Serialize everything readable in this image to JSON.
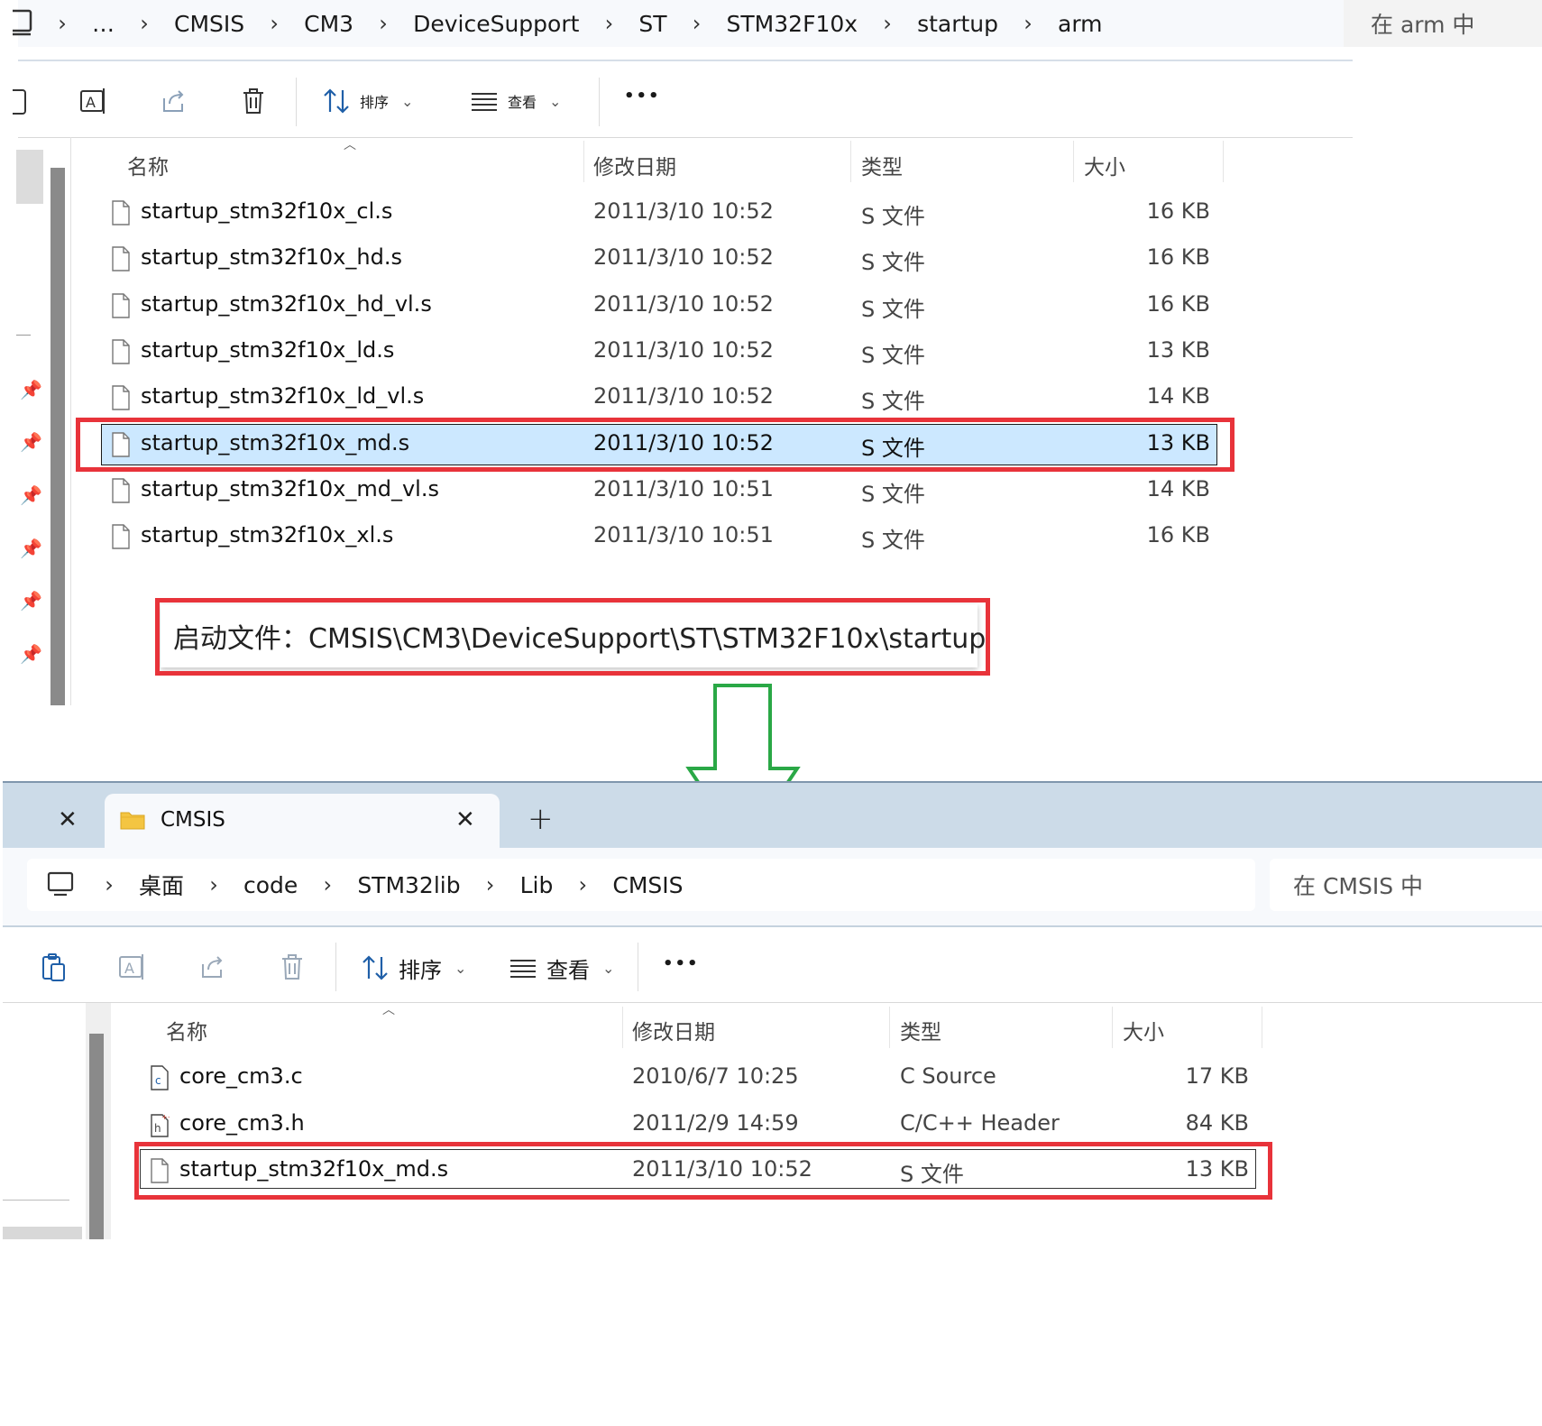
{
  "top": {
    "breadcrumb": [
      "…",
      "CMSIS",
      "CM3",
      "DeviceSupport",
      "ST",
      "STM32F10x",
      "startup",
      "arm"
    ],
    "search_placeholder": "在 arm 中",
    "toolbar": {
      "sort_label": "排序",
      "view_label": "查看",
      "more_label": "•••"
    },
    "columns": {
      "name": "名称",
      "date": "修改日期",
      "type": "类型",
      "size": "大小"
    },
    "files": [
      {
        "name": "startup_stm32f10x_cl.s",
        "date": "2011/3/10 10:52",
        "type": "S 文件",
        "size": "16 KB"
      },
      {
        "name": "startup_stm32f10x_hd.s",
        "date": "2011/3/10 10:52",
        "type": "S 文件",
        "size": "16 KB"
      },
      {
        "name": "startup_stm32f10x_hd_vl.s",
        "date": "2011/3/10 10:52",
        "type": "S 文件",
        "size": "16 KB"
      },
      {
        "name": "startup_stm32f10x_ld.s",
        "date": "2011/3/10 10:52",
        "type": "S 文件",
        "size": "13 KB"
      },
      {
        "name": "startup_stm32f10x_ld_vl.s",
        "date": "2011/3/10 10:52",
        "type": "S 文件",
        "size": "14 KB"
      },
      {
        "name": "startup_stm32f10x_md.s",
        "date": "2011/3/10 10:52",
        "type": "S 文件",
        "size": "13 KB",
        "selected": true
      },
      {
        "name": "startup_stm32f10x_md_vl.s",
        "date": "2011/3/10 10:51",
        "type": "S 文件",
        "size": "14 KB"
      },
      {
        "name": "startup_stm32f10x_xl.s",
        "date": "2011/3/10 10:51",
        "type": "S 文件",
        "size": "16 KB"
      }
    ]
  },
  "note": "启动文件：CMSIS\\CM3\\DeviceSupport\\ST\\STM32F10x\\startup",
  "bottom": {
    "tab": {
      "title": "CMSIS",
      "add_label": "+"
    },
    "breadcrumb": [
      "桌面",
      "code",
      "STM32lib",
      "Lib",
      "CMSIS"
    ],
    "search_placeholder": "在 CMSIS 中",
    "toolbar": {
      "sort_label": "排序",
      "view_label": "查看",
      "more_label": "•••"
    },
    "columns": {
      "name": "名称",
      "date": "修改日期",
      "type": "类型",
      "size": "大小"
    },
    "files": [
      {
        "name": "core_cm3.c",
        "date": "2010/6/7 10:25",
        "type": "C Source",
        "size": "17 KB",
        "icon": "c-source-file-icon"
      },
      {
        "name": "core_cm3.h",
        "date": "2011/2/9 14:59",
        "type": "C/C++ Header",
        "size": "84 KB",
        "icon": "c-header-file-icon"
      },
      {
        "name": "startup_stm32f10x_md.s",
        "date": "2011/3/10 10:52",
        "type": "S 文件",
        "size": "13 KB",
        "icon": "file-icon"
      }
    ]
  },
  "colors": {
    "highlight": "#e8333a",
    "arrow": "#2aa846",
    "selection": "#cce8ff"
  }
}
